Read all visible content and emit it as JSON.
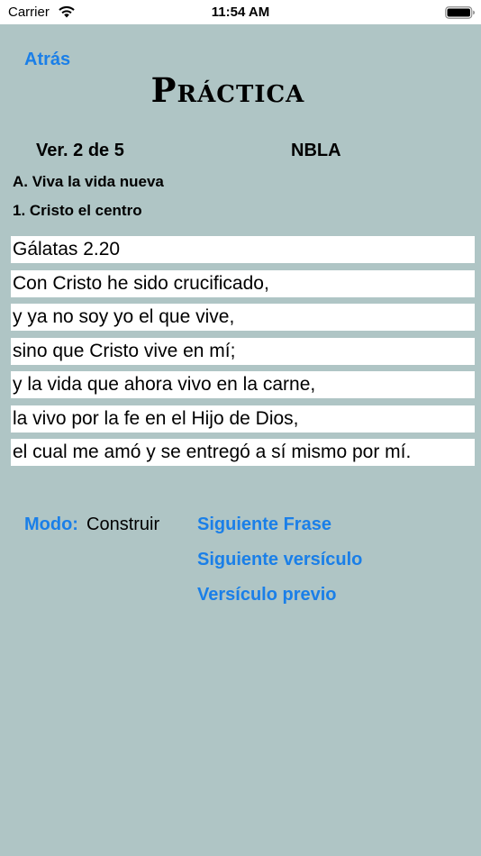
{
  "status_bar": {
    "carrier": "Carrier",
    "time": "11:54 AM",
    "icons": [
      "wifi-icon",
      "battery-icon"
    ]
  },
  "nav": {
    "back_label": "Atrás"
  },
  "title": "Práctica",
  "info": {
    "version": "Ver. 2 de 5",
    "translation": "NBLA",
    "section": "A. Viva la vida nueva",
    "subsection": "1. Cristo el centro"
  },
  "verse": {
    "lines": [
      "Gálatas 2.20",
      "Con Cristo he sido crucificado,",
      "y ya no soy yo el que vive,",
      "sino que Cristo vive en mí;",
      "y la vida que ahora vivo en la carne,",
      "la vivo por la fe en el Hijo de Dios,",
      "el cual me amó y se entregó a sí mismo por mí."
    ]
  },
  "controls": {
    "mode_label": "Modo:",
    "mode_value": "Construir",
    "next_phrase": "Siguiente Frase",
    "next_verse": "Siguiente versículo",
    "prev_verse": "Versículo previo"
  },
  "colors": {
    "background": "#afc5c5",
    "accent": "#1a7fe8",
    "line_background": "#ffffff"
  }
}
